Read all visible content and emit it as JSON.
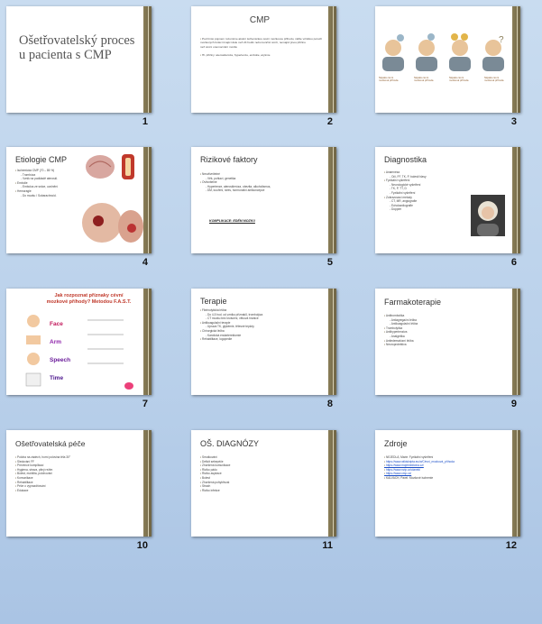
{
  "slides": [
    {
      "num": "1",
      "title": "Ošetřovatelský proces u pacienta s CMP"
    },
    {
      "num": "2",
      "title": "CMP",
      "body": [
        "Pod tímto pojmem rozumíme akutní ischemickou cévní mozkovou příhodu, náhle vzniklou poruchu",
        "mozkových funkcí trvající déle než 24 hodin nebo končící smrtí, nemající jinou příčinu",
        "než cévní onemocnění mozku",
        "",
        "Hl. příčiny: ateroskleróza, hypertenze, embolie, arytmie"
      ]
    },
    {
      "num": "3",
      "captions": [
        "Nějaká cévní mozková příhoda",
        "Nějaká cévní mozková příhoda",
        "Nějaká cévní mozková příhoda",
        "Nějaká cévní mozková příhoda"
      ]
    },
    {
      "num": "4",
      "title": "Etiologie CMP",
      "body": [
        {
          "t": "Ischemická CMP (70 – 85 %)",
          "l": 1
        },
        {
          "t": "Trombóza",
          "l": 2
        },
        {
          "t": "Vznik na podkladě ateroskl.",
          "l": 2
        },
        {
          "t": "Embolie",
          "l": 1
        },
        {
          "t": "Embolus ze srdce, uvolnění",
          "l": 2
        },
        {
          "t": "Hemoragie",
          "l": 1
        },
        {
          "t": "Do mozku / Subarachnoid.",
          "l": 2
        }
      ]
    },
    {
      "num": "5",
      "title": "Rizikové faktory",
      "body": [
        {
          "t": "Neovlivnitelné",
          "l": 1
        },
        {
          "t": "Věk, pohlaví, genetika",
          "l": 2
        },
        {
          "t": "Ovlivnitelné",
          "l": 1
        },
        {
          "t": "Hypertenze, ateroskleróza, obezita, alkoholismus,",
          "l": 2
        },
        {
          "t": "DM, kouření, stres, hormonální antikoncepce",
          "l": 2
        }
      ],
      "note": "KOMPLIKACE: EDÉM MOZKU"
    },
    {
      "num": "6",
      "title": "Diagnostika",
      "body": [
        {
          "t": "Anamnéza",
          "l": 1
        },
        {
          "t": "Oči, FF, TK, P, bolesti hlavy",
          "l": 2
        },
        {
          "t": "Fyzikální vyšetření",
          "l": 1
        },
        {
          "t": "Neurologické vyšetření",
          "l": 2
        },
        {
          "t": "TK, P, TT, D",
          "l": 2
        },
        {
          "t": "Fyzikální vyšetření",
          "l": 2
        },
        {
          "t": "Zobrazovací metody",
          "l": 1
        },
        {
          "t": "CT, MR, angiografie",
          "l": 2
        },
        {
          "t": "Echokardiografie",
          "l": 2
        },
        {
          "t": "Doppler",
          "l": 2
        }
      ]
    },
    {
      "num": "7",
      "title": "Jak rozpoznat příznaky cévní mozkové příhody? Metodou F.A.S.T.",
      "fast": [
        "Face",
        "Arm",
        "Speech",
        "Time"
      ]
    },
    {
      "num": "8",
      "title": "Terapie",
      "body": [
        {
          "t": "Fibrinolytická léčba",
          "l": 1
        },
        {
          "t": "Do 4,5 hod. od vzniku příznaků, trombolýza",
          "l": 2
        },
        {
          "t": "CT mozku bez krvácení, věková hranice",
          "l": 2
        },
        {
          "t": "Antikoagulační terapie",
          "l": 1
        },
        {
          "t": "Úprava TK, glykémie, tělesné teploty",
          "l": 2
        },
        {
          "t": "Chirurgická léčba",
          "l": 1
        },
        {
          "t": "Karotická endarterektomie",
          "l": 2
        },
        {
          "t": "Rehabilitace, logopedie",
          "l": 1
        }
      ]
    },
    {
      "num": "9",
      "title": "Farmakoterapie",
      "body": [
        {
          "t": "Antitrombotika",
          "l": 1
        },
        {
          "t": "Antiagregační léčba",
          "l": 2
        },
        {
          "t": "Antikoagulační léčba",
          "l": 2
        },
        {
          "t": "Trombolytika",
          "l": 1
        },
        {
          "t": "Antihypertenziva",
          "l": 1
        },
        {
          "t": "Analgetika",
          "l": 2
        },
        {
          "t": "Antiedematózní léčba",
          "l": 1
        },
        {
          "t": "Neuroprotektiva",
          "l": 1
        }
      ]
    },
    {
      "num": "10",
      "title": "Ošetřovatelská péče",
      "body": [
        {
          "t": "Poloha na zádech, horní polovina těla 30°",
          "l": 1
        },
        {
          "t": "Sledování FF",
          "l": 1
        },
        {
          "t": "Prevence komplikací",
          "l": 1
        },
        {
          "t": "Hygiena, strava, pitný režim",
          "l": 1
        },
        {
          "t": "Bolest, mobilita, polohování",
          "l": 1
        },
        {
          "t": "Komunikace",
          "l": 1
        },
        {
          "t": "Rehabilitace",
          "l": 1
        },
        {
          "t": "Péče o vyprazdňování",
          "l": 1
        },
        {
          "t": "Edukace",
          "l": 1
        }
      ]
    },
    {
      "num": "11",
      "title": "OŠ. DIAGNÓZY",
      "body": [
        {
          "t": "Smutkování",
          "l": 1
        },
        {
          "t": "Deficit sebepéče",
          "l": 1
        },
        {
          "t": "Zhoršená komunikace",
          "l": 1
        },
        {
          "t": "Riziko pádu",
          "l": 1
        },
        {
          "t": "Riziko aspirace",
          "l": 1
        },
        {
          "t": "Bolest",
          "l": 1
        },
        {
          "t": "Zhoršená pohyblivost",
          "l": 1
        },
        {
          "t": "Strach",
          "l": 1
        },
        {
          "t": "Riziko infekce",
          "l": 1
        }
      ]
    },
    {
      "num": "12",
      "title": "Zdroje",
      "body": [
        {
          "t": "NEJEDLÁ, Marie. Fyzikální vyšetření",
          "l": 1
        },
        {
          "t": "https://www.wikiskripta.eu/w/Cévní_mozková_příhoda",
          "l": 1,
          "link": true
        },
        {
          "t": "https://www.mojemedicina.cz/",
          "l": 1,
          "link": true
        },
        {
          "t": "https://www.nzip.cz/clanek/",
          "l": 1,
          "link": true
        },
        {
          "t": "https://www.cmp.cz/",
          "l": 1,
          "link": true
        },
        {
          "t": "KALVACH, Pavel. Mozkové ischemie",
          "l": 1
        }
      ]
    }
  ]
}
